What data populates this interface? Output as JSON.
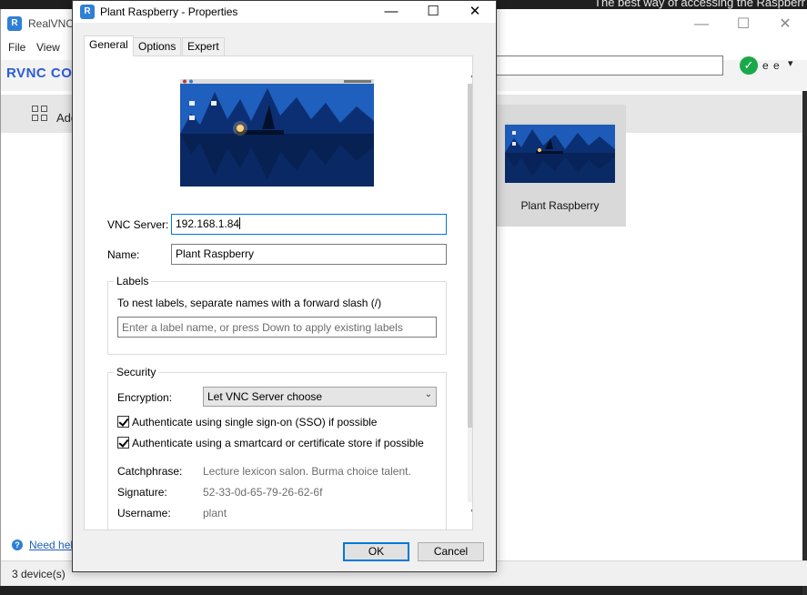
{
  "background": {
    "tagline": "The best way of accessing the Raspberr",
    "app_title": "RealVNC",
    "app_logo": "R",
    "menu": [
      "File",
      "View"
    ],
    "brand": "RVNC CONN",
    "add_label": "Add",
    "user_initials": "e e",
    "device_name": "Plant Raspberry",
    "help_link": "Need hel",
    "status": "3 device(s)",
    "window_controls": {
      "minimize": "—",
      "maximize": "☐",
      "close": "✕"
    }
  },
  "dialog": {
    "title": "Plant Raspberry - Properties",
    "logo": "R",
    "controls": {
      "minimize": "—",
      "maximize": "☐",
      "close": "✕"
    },
    "tabs": [
      "General",
      "Options",
      "Expert"
    ],
    "vnc_server_label": "VNC Server:",
    "vnc_server_value": "192.168.1.84",
    "name_label": "Name:",
    "name_value": "Plant Raspberry",
    "labels": {
      "title": "Labels",
      "hint": "To nest labels, separate names with a forward slash (/)",
      "placeholder": "Enter a label name, or press Down to apply existing labels"
    },
    "security": {
      "title": "Security",
      "encryption_label": "Encryption:",
      "encryption_value": "Let VNC Server choose",
      "sso_label": "Authenticate using single sign-on (SSO) if possible",
      "sso_checked": true,
      "smartcard_label": "Authenticate using a smartcard or certificate store if possible",
      "smartcard_checked": true,
      "catchphrase_label": "Catchphrase:",
      "catchphrase_value": "Lecture lexicon salon. Burma choice talent.",
      "signature_label": "Signature:",
      "signature_value": "52-33-0d-65-79-26-62-6f",
      "username_label": "Username:",
      "username_value": "plant"
    },
    "ok_label": "OK",
    "cancel_label": "Cancel",
    "accent_color": "#0078d7"
  }
}
